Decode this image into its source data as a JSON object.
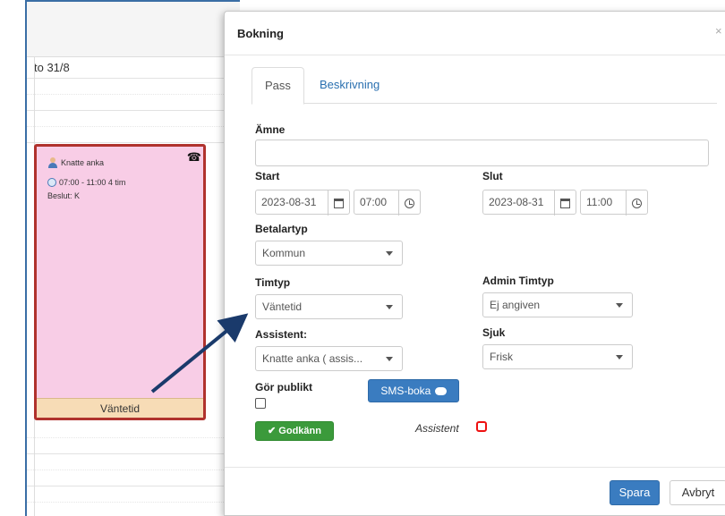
{
  "calendar": {
    "day_label": "to 31/8",
    "event": {
      "name": "Knatte anka",
      "time": "07:00 - 11:00  4 tim",
      "beslut": "Beslut: K",
      "status": "Väntetid",
      "icons": [
        "user-icon",
        "clock-icon",
        "phone-icon"
      ]
    }
  },
  "modal": {
    "title": "Bokning",
    "close": "×",
    "tabs": [
      {
        "label": "Pass",
        "active": true
      },
      {
        "label": "Beskrivning",
        "active": false
      }
    ],
    "amne_label": "Ämne",
    "amne_value": "",
    "start_label": "Start",
    "start_date": "2023-08-31",
    "start_time": "07:00",
    "slut_label": "Slut",
    "slut_date": "2023-08-31",
    "slut_time": "11:00",
    "betalartyp_label": "Betalartyp",
    "betalartyp_value": "Kommun",
    "timtyp_label": "Timtyp",
    "timtyp_value": "Väntetid",
    "admin_timtyp_label": "Admin Timtyp",
    "admin_timtyp_value": "Ej angiven",
    "assistent_label": "Assistent:",
    "assistent_value": "Knatte anka ( assis...",
    "sjuk_label": "Sjuk",
    "sjuk_value": "Frisk",
    "gor_publikt_label": "Gör publikt",
    "sms_button": "SMS-boka",
    "godkann_button": "Godkänn",
    "assistent_flag_label": "Assistent",
    "spara_button": "Spara",
    "avbryt_button": "Avbryt"
  },
  "colors": {
    "event_bg": "#f8cde6",
    "event_border": "#b0322d",
    "event_footer": "#f7dcb6",
    "primary": "#3a7cc0",
    "success": "#3b9a3b",
    "arrow": "#1a3a6b"
  }
}
